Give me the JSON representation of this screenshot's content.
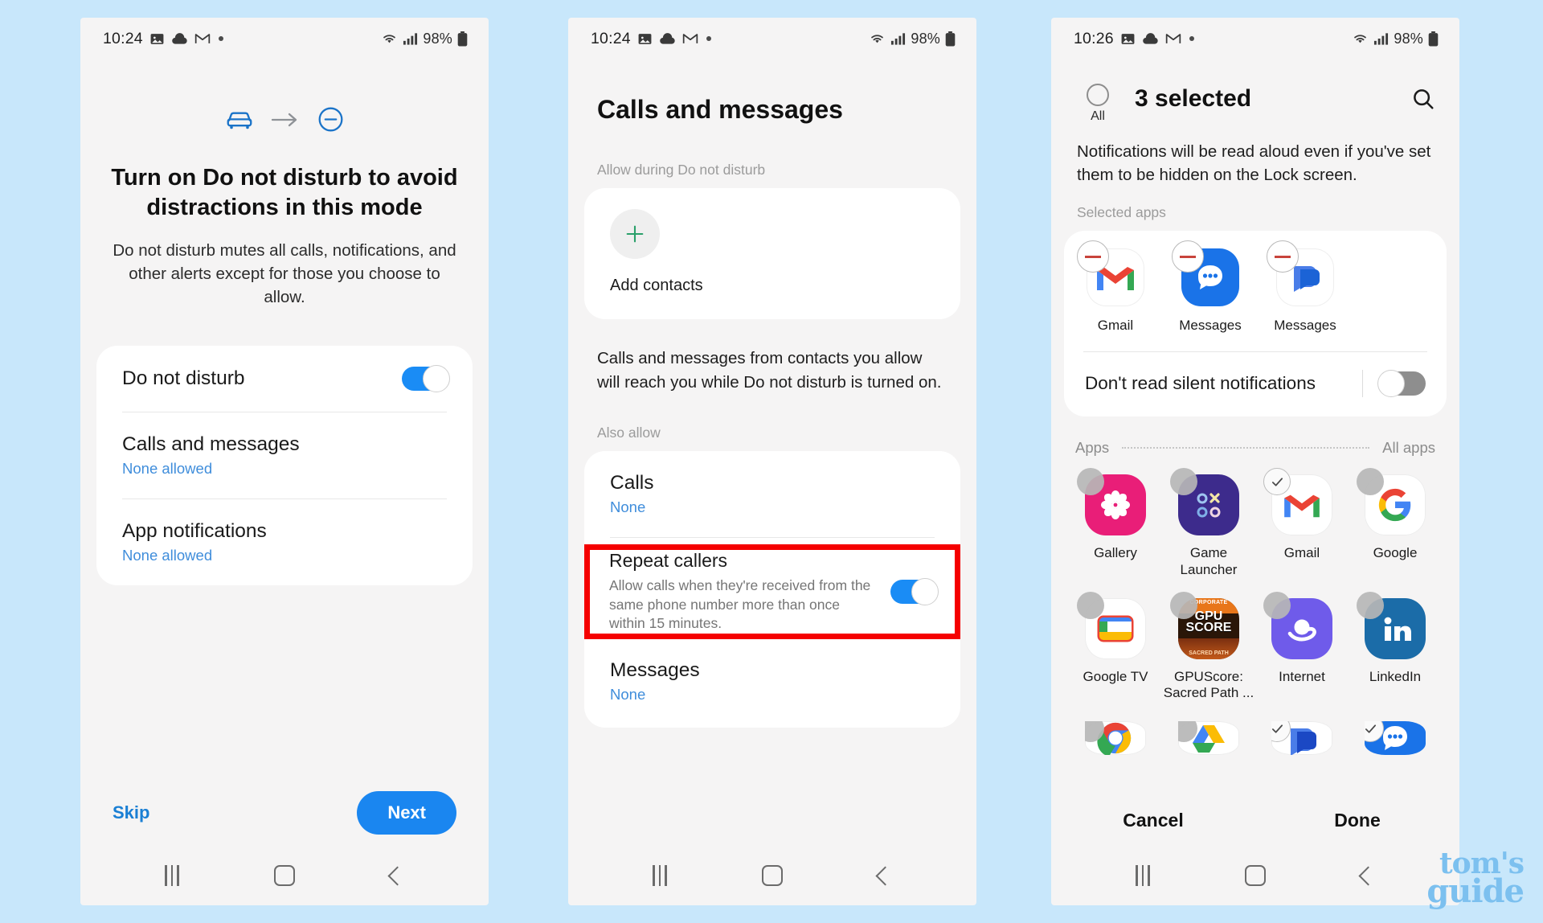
{
  "page": {
    "background_color": "#c8e7fb",
    "watermark": {
      "line1": "tom's",
      "line2": "guide"
    }
  },
  "screen1": {
    "status_bar": {
      "time": "10:24",
      "battery_percent": "98%",
      "icons": [
        "image-icon",
        "cloud-icon",
        "gmail-icon",
        "dot-indicator",
        "wifi-icon",
        "signal-icon",
        "battery-icon"
      ]
    },
    "hero_icons": {
      "from": "car-icon",
      "arrow": "arrow-right-icon",
      "to": "do-not-disturb-icon"
    },
    "title": "Turn on Do not disturb to avoid distractions in this mode",
    "description": "Do not disturb mutes all calls, notifications, and other alerts except for those you choose to allow.",
    "rows": [
      {
        "title": "Do not disturb",
        "toggle": "on"
      },
      {
        "title": "Calls and messages",
        "sub": "None allowed"
      },
      {
        "title": "App notifications",
        "sub": "None allowed"
      }
    ],
    "skip_label": "Skip",
    "next_label": "Next"
  },
  "screen2": {
    "status_bar": {
      "time": "10:24",
      "battery_percent": "98%"
    },
    "title": "Calls and messages",
    "section_allow": "Allow during Do not disturb",
    "add_contacts_label": "Add contacts",
    "paragraph": "Calls and messages from contacts you allow will reach you while Do not disturb is turned on.",
    "section_also_allow": "Also allow",
    "rows": [
      {
        "title": "Calls",
        "sub": "None"
      },
      {
        "title": "Repeat callers",
        "desc": "Allow calls when they're received from the same phone number more than once within 15 minutes.",
        "toggle": "on",
        "highlighted": true
      },
      {
        "title": "Messages",
        "sub": "None"
      }
    ],
    "highlight_color": "#f50000"
  },
  "screen3": {
    "status_bar": {
      "time": "10:26",
      "battery_percent": "98%"
    },
    "all_label": "All",
    "count_label": "3 selected",
    "search_icon": "search-icon",
    "note": "Notifications will be read aloud even if you've set them to be hidden on the Lock screen.",
    "selected_apps_label": "Selected apps",
    "selected_apps": [
      {
        "name": "Gmail",
        "icon": "gmail-icon"
      },
      {
        "name": "Messages",
        "icon": "messages-icon"
      },
      {
        "name": "Messages",
        "icon": "messages-chat-icon"
      }
    ],
    "silent_label": "Don't read silent notifications",
    "silent_toggle": "off",
    "apps_divider": {
      "left": "Apps",
      "right": "All apps"
    },
    "app_grid": [
      {
        "name": "Gallery",
        "icon": "gallery-icon",
        "selected": false
      },
      {
        "name": "Game Launcher",
        "icon": "game-launcher-icon",
        "selected": false
      },
      {
        "name": "Gmail",
        "icon": "gmail-icon",
        "selected": true
      },
      {
        "name": "Google",
        "icon": "google-icon",
        "selected": false
      },
      {
        "name": "Google TV",
        "icon": "google-tv-icon",
        "selected": false
      },
      {
        "name": "GPUScore: Sacred Path ...",
        "icon": "gpuscore-icon",
        "selected": false
      },
      {
        "name": "Internet",
        "icon": "internet-icon",
        "selected": false
      },
      {
        "name": "LinkedIn",
        "icon": "linkedin-icon",
        "selected": false
      }
    ],
    "app_grid_partial": [
      {
        "icon": "chrome-icon",
        "selected": false
      },
      {
        "icon": "drive-icon",
        "selected": false
      },
      {
        "icon": "messages-blue-icon",
        "selected": true
      },
      {
        "icon": "messages-icon",
        "selected": true
      }
    ],
    "cancel_label": "Cancel",
    "done_label": "Done"
  }
}
